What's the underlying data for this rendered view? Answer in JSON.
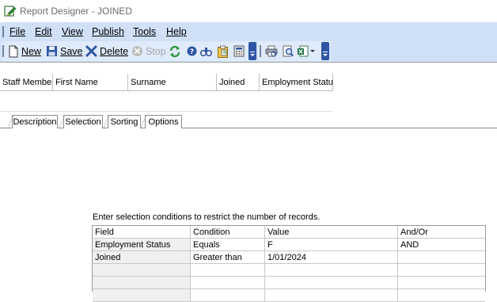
{
  "window": {
    "title": "Report Designer - JOINED",
    "app_icon": "pencil-edit-icon"
  },
  "menu": {
    "items": [
      {
        "label": "File"
      },
      {
        "label": "Edit"
      },
      {
        "label": "View"
      },
      {
        "label": "Publish"
      },
      {
        "label": "Tools"
      },
      {
        "label": "Help"
      }
    ]
  },
  "toolbar": {
    "new_label": "New",
    "save_label": "Save",
    "delete_label": "Delete",
    "stop_label": "Stop"
  },
  "report_columns": [
    "Staff Member",
    "First Name",
    "Surname",
    "Joined",
    "Employment Status"
  ],
  "tabs": [
    "Description",
    "Selection",
    "Sorting",
    "Options"
  ],
  "active_tab": "Selection",
  "selection": {
    "instruction": "Enter selection conditions to restrict the number of records.",
    "headers": [
      "Field",
      "Condition",
      "Value",
      "And/Or"
    ],
    "rows": [
      [
        "Employment Status",
        "Equals",
        "F",
        "AND"
      ],
      [
        "Joined",
        "Greater than",
        "1/01/2024",
        ""
      ],
      [
        "",
        "",
        "",
        ""
      ],
      [
        "",
        "",
        "",
        ""
      ],
      [
        "",
        "",
        "",
        ""
      ]
    ]
  },
  "colors": {
    "menu_bg": "#cfe0f7",
    "toolbar_bg": "#dfeafb",
    "overflow_button": "#2f55a4",
    "title_text": "#6b6b6b"
  }
}
